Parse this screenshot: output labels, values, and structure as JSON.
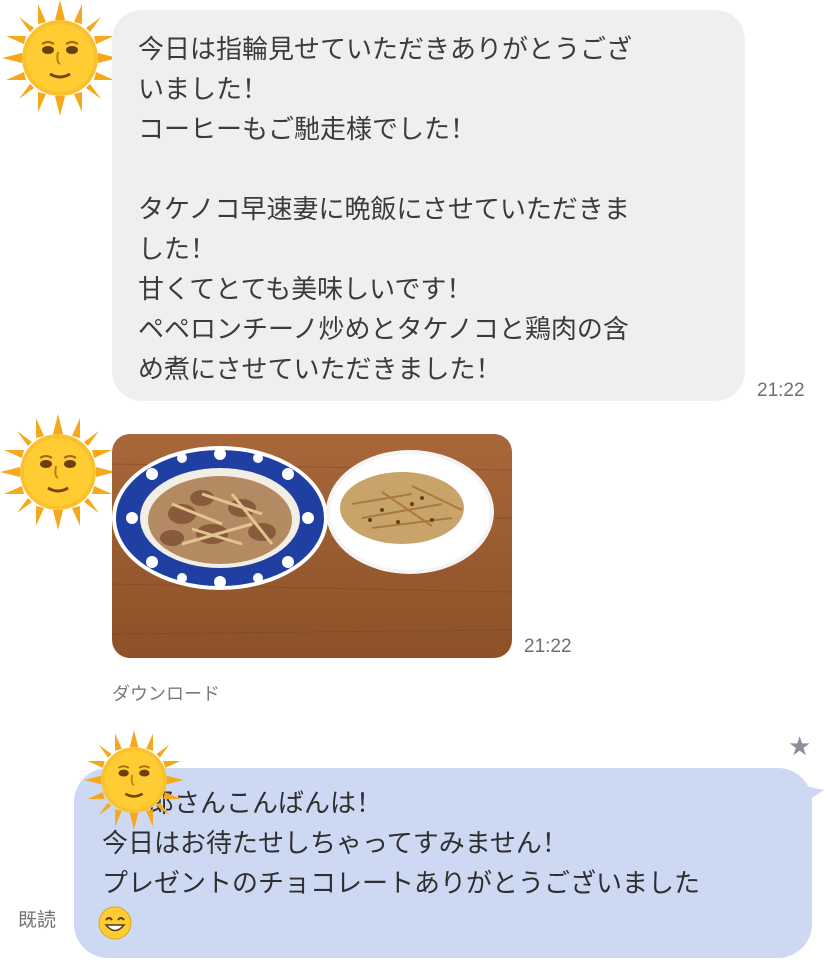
{
  "messages": {
    "incoming_text": {
      "lines": [
        "今日は指輪見せていただきありがとうござ",
        "いました！",
        "コーヒーもご馳走様でした！",
        "",
        "タケノコ早速妻に晩飯にさせていただきま",
        "した！",
        "甘くてとても美味しいです！",
        "ペペロンチーノ炒めとタケノコと鶏肉の含",
        "め煮にさせていただきました！"
      ],
      "time": "21:22"
    },
    "incoming_photo": {
      "time": "21:22",
      "download_label": "ダウンロード"
    },
    "outgoing_text": {
      "lines": [
        "郎さんこんばんは！",
        "今日はお待たせしちゃってすみません！",
        "プレゼントのチョコレートありがとうございました",
        ""
      ],
      "read_label": "既読",
      "star_icon": "star-icon"
    }
  },
  "colors": {
    "incoming_bubble": "#eeeff1",
    "outgoing_bubble": "#cdd9f3",
    "timestamp": "#6f6f6f"
  }
}
